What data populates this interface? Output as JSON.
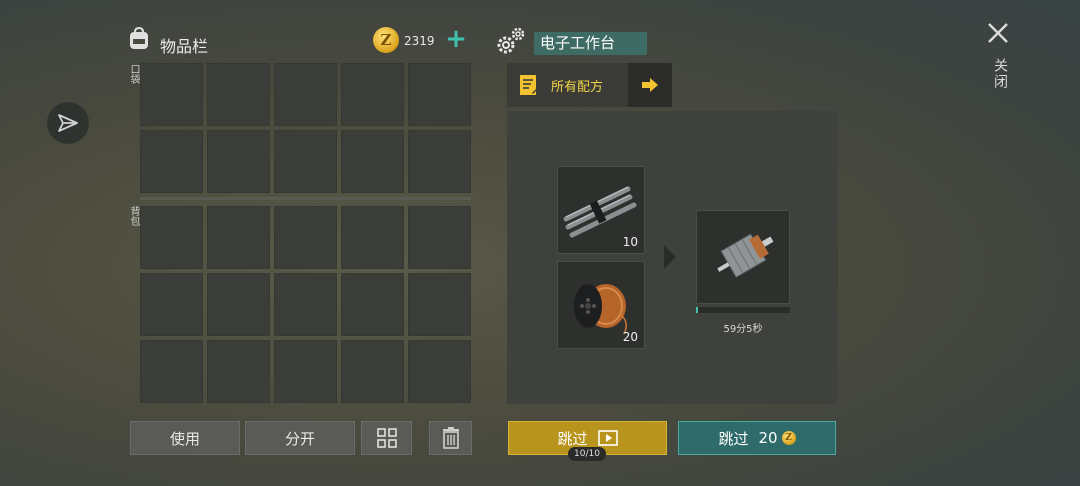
{
  "inventory": {
    "title": "物品栏",
    "coins": "2319",
    "pocket_label": "口袋",
    "backpack_label": "背包",
    "pocket_rows": 2,
    "backpack_rows": 3,
    "columns": 5
  },
  "actions": {
    "use_label": "使用",
    "split_label": "分开",
    "sort_icon": "grid-sort-icon",
    "trash_icon": "trash-icon"
  },
  "workbench": {
    "title": "电子工作台",
    "recipes_label": "所有配方",
    "ingredients": [
      {
        "icon": "metal-rods-icon",
        "qty": "10"
      },
      {
        "icon": "copper-wire-spool-icon",
        "qty": "20"
      }
    ],
    "output": {
      "icon": "electric-motor-icon",
      "timer": "59分5秒",
      "progress": 0.02
    }
  },
  "skip": {
    "ad_label": "跳过",
    "ad_count": "10/10",
    "coin_label": "跳过",
    "coin_cost": "20"
  },
  "close_label": "关闭",
  "colors": {
    "accent_teal": "#3fc1b0",
    "bench_title_bg": "#3e6b64",
    "skip_ad_bg": "#b8941c",
    "skip_coin_bg": "#2e6b6a",
    "coin_gold": "#d9a21a"
  }
}
